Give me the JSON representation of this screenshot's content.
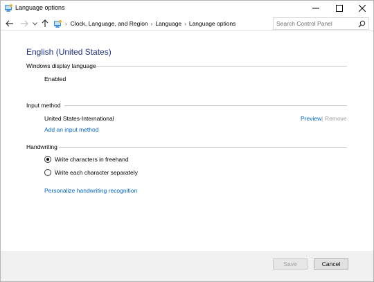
{
  "window": {
    "title": "Language options"
  },
  "address_bar": {
    "breadcrumbs": [
      "Clock, Language, and Region",
      "Language",
      "Language options"
    ],
    "search_placeholder": "Search Control Panel"
  },
  "page": {
    "heading": "English (United States)",
    "display_language": {
      "title": "Windows display language",
      "status": "Enabled"
    },
    "input_method": {
      "title": "Input method",
      "item": "United States-International",
      "preview_link": "Preview",
      "separator": "|",
      "remove_link": "Remove",
      "add_link": "Add an input method"
    },
    "handwriting": {
      "title": "Handwriting",
      "options": [
        {
          "label": "Write characters in freehand",
          "selected": true
        },
        {
          "label": "Write each character separately",
          "selected": false
        }
      ],
      "personalize_link": "Personalize handwriting recognition"
    }
  },
  "footer": {
    "save_label": "Save",
    "cancel_label": "Cancel"
  },
  "colors": {
    "heading": "#1e3287",
    "link": "#0066cc",
    "disabled": "#a0a0a0"
  }
}
